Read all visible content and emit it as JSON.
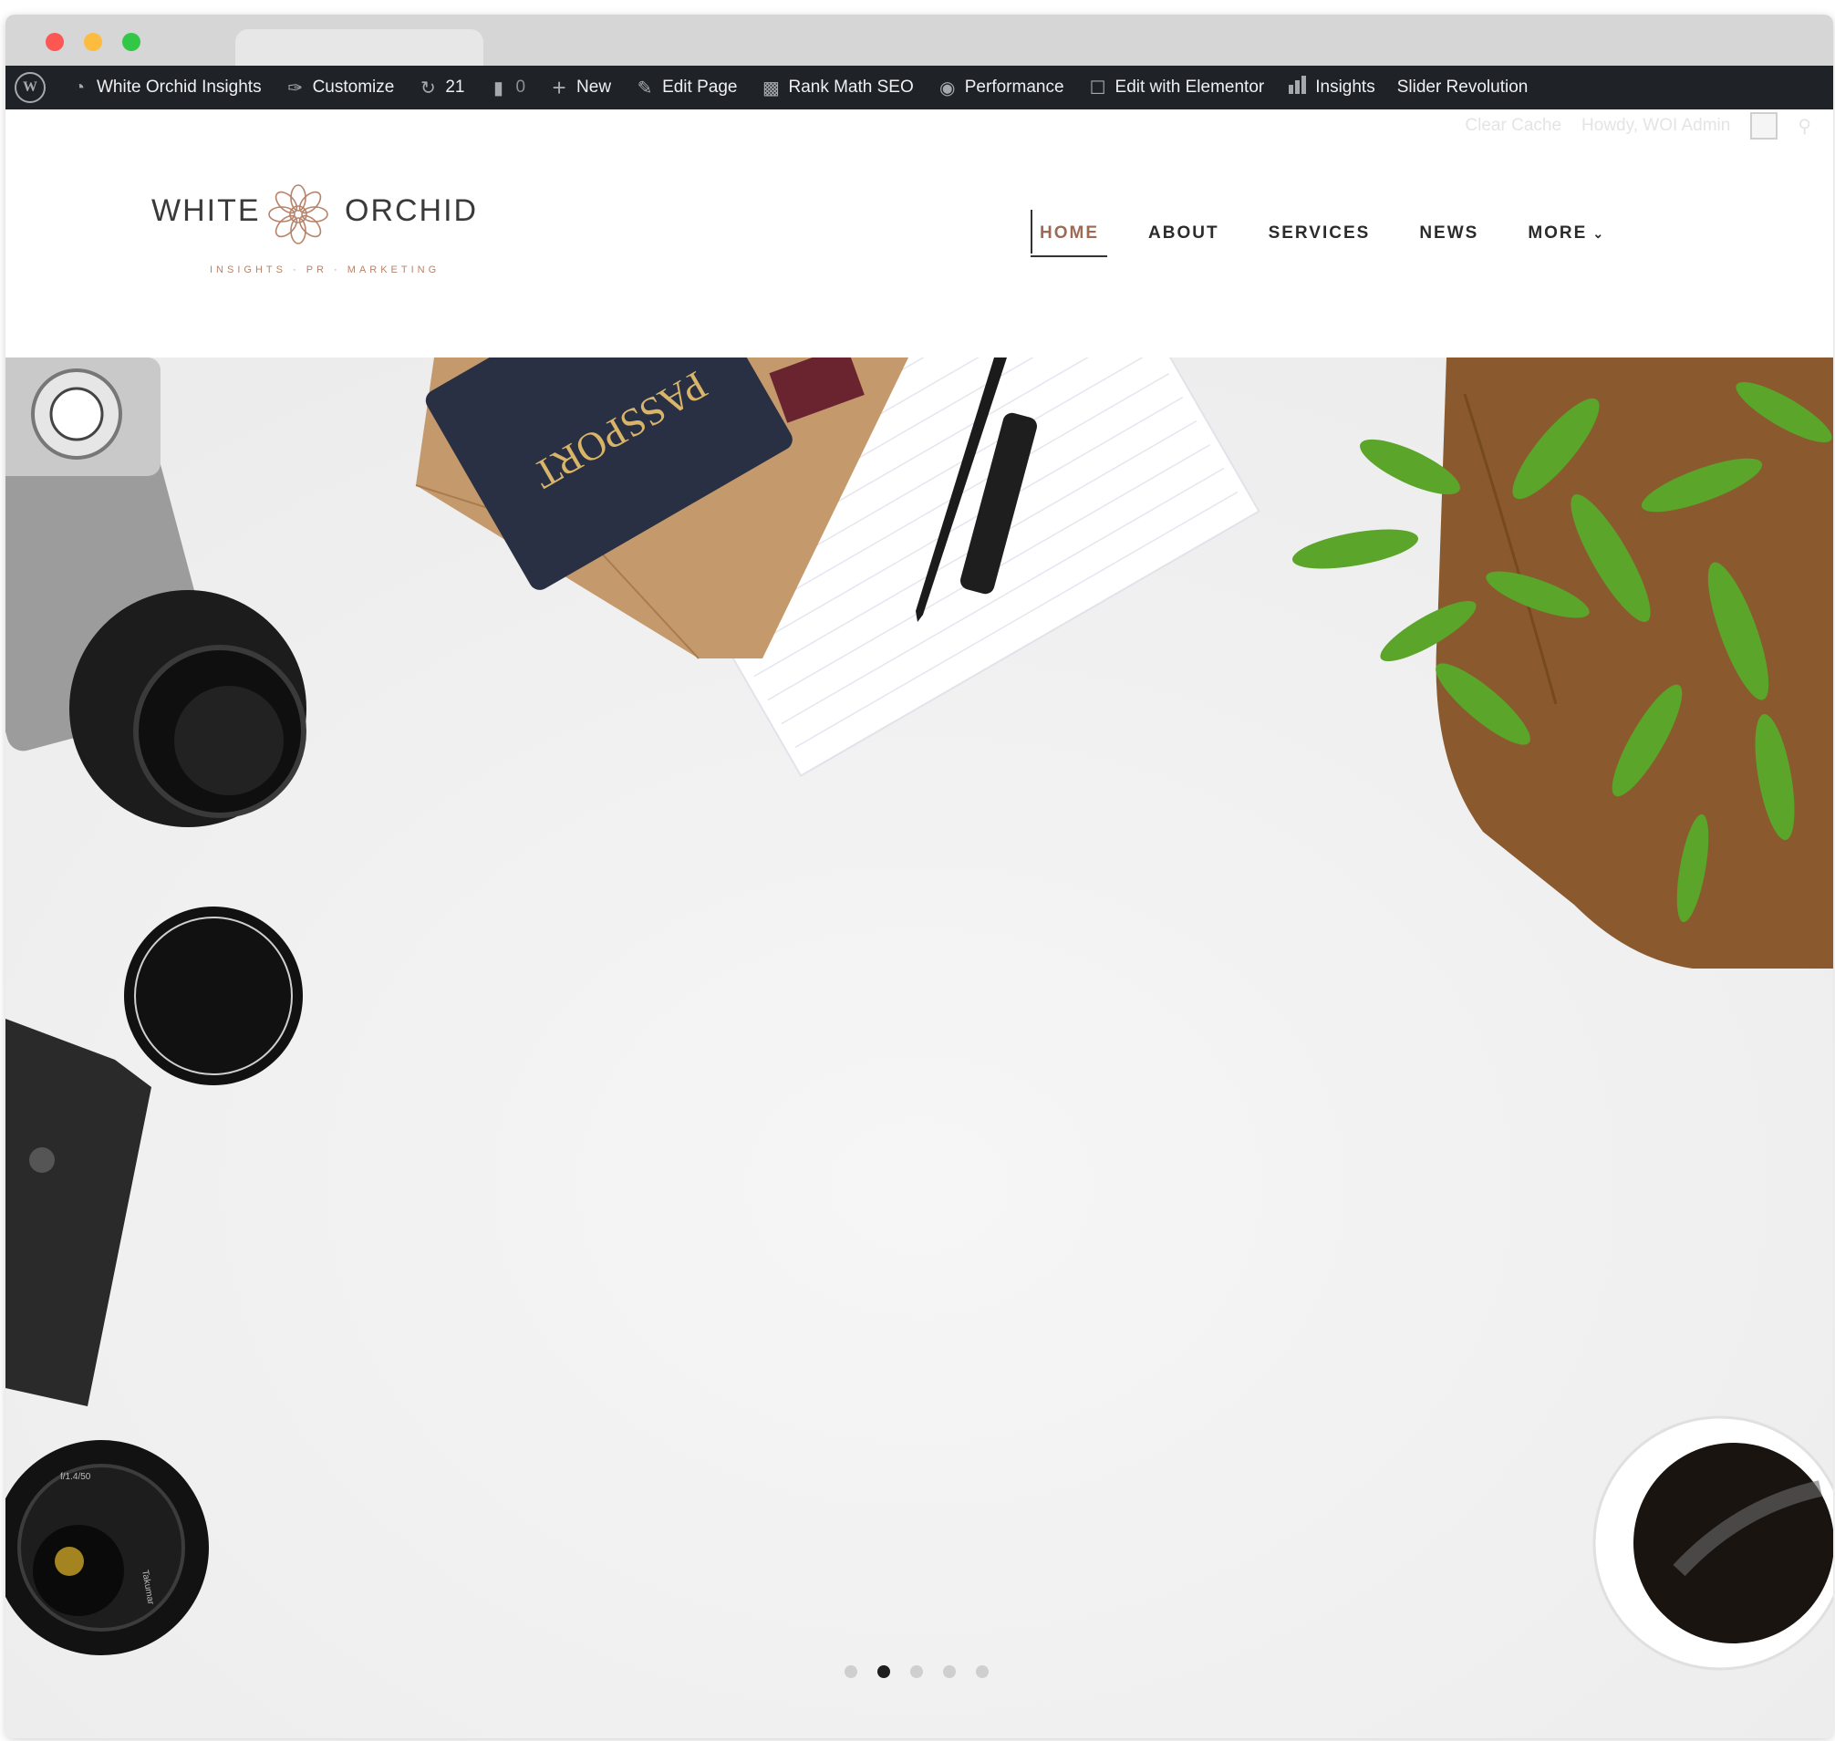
{
  "admin_bar": {
    "site_name": "White Orchid Insights",
    "customize": "Customize",
    "updates_count": "21",
    "comments_count": "0",
    "new_label": "New",
    "edit_page": "Edit Page",
    "rank_math": "Rank Math SEO",
    "performance": "Performance",
    "elementor": "Edit with Elementor",
    "insights": "Insights",
    "slider_revolution": "Slider Revolution"
  },
  "secondary_bar": {
    "clear_cache": "Clear Cache",
    "howdy": "Howdy, WOI Admin"
  },
  "logo": {
    "left_word": "WHITE",
    "right_word": "ORCHID",
    "tagline": "INSIGHTS · PR · MARKETING"
  },
  "nav": {
    "items": [
      {
        "label": "HOME",
        "active": true
      },
      {
        "label": "ABOUT"
      },
      {
        "label": "SERVICES"
      },
      {
        "label": "NEWS"
      },
      {
        "label": "MORE",
        "has_dropdown": true
      }
    ]
  },
  "passport_text": "PASSPORT",
  "lens_text_1": "f/1.4/50",
  "lens_text_2": "Takumar",
  "slider": {
    "total": 5,
    "active_index": 1
  },
  "colors": {
    "admin_bar": "#1f2327",
    "accent": "#9c6a55",
    "plant_green": "#5aa52a",
    "envelope": "#c49a6c",
    "passport": "#2a3043",
    "board": "#8a5a2e"
  },
  "icons": [
    "wordpress-icon",
    "dashboard-icon",
    "brush-icon",
    "updates-icon",
    "comment-icon",
    "plus-icon",
    "pencil-icon",
    "rank-math-icon",
    "performance-icon",
    "elementor-icon",
    "bar-chart-icon",
    "avatar-icon",
    "search-icon",
    "chevron-down-icon",
    "orchid-logo-icon"
  ]
}
